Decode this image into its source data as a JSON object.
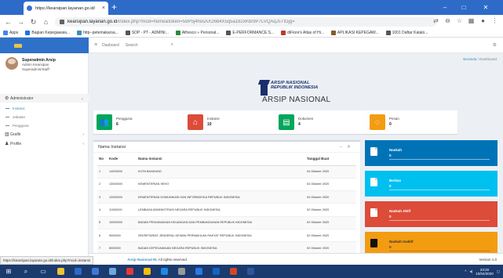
{
  "browser": {
    "tab_title": "https://kearsipan.layanan.go.id/",
    "url_domain": "kearsipan.layanan.go.id",
    "url_path": "/index.php?mod=home&token=59P5j4hosAX26b4X5q5a182xKbr9P7LVQAqJsTfDjg=",
    "bookmarks": [
      {
        "label": "Apps",
        "color": "#4285f4"
      },
      {
        "label": "Bagian Kepegawaia...",
        "color": "#1a73e8"
      },
      {
        "label": "http--petemakarsa...",
        "color": "#3c8dbc"
      },
      {
        "label": "SOP - PT - ADMINI...",
        "color": "#555555"
      },
      {
        "label": "Alfresco » Personal...",
        "color": "#2c8b3c"
      },
      {
        "label": "E-PERFORMANCE S...",
        "color": "#555555"
      },
      {
        "label": "diFiore's Atlas of Hi...",
        "color": "#c0392b"
      },
      {
        "label": "APLIKASI KEPEGAW...",
        "color": "#8a5a2b"
      },
      {
        "label": "1001 Daftar Katalo...",
        "color": "#555555"
      }
    ],
    "status_url": "https://kearsipan.layanan.go.id/index.php?mod=instansi"
  },
  "sidebar": {
    "brand": "Arsip",
    "user_name": "Superadmin Arsip",
    "user_role1": "Admin Kearsipan",
    "user_role2": "Superadmin/Staff",
    "admin_label": "Administrator",
    "sub_items": [
      "Instansi",
      "Jabatan",
      "Pengguna"
    ],
    "grafik_label": "Grafik",
    "profile_label": "Profile"
  },
  "topnav": {
    "link": "Dasboard",
    "search": "Search"
  },
  "breadcrumb": {
    "home": "Beranda",
    "current": "Dashboard"
  },
  "logo": {
    "line1": "ARSIP NASIONAL",
    "line2": "REPUBLIK INDONESIA",
    "title": "ARSIP NASIONAL"
  },
  "infoboxes": [
    {
      "label": "Pengguna",
      "value": "6",
      "color": "#00a65a",
      "icon": "users-icon"
    },
    {
      "label": "Instansi",
      "value": "10",
      "color": "#dd4b39",
      "icon": "home-icon"
    },
    {
      "label": "Dokumen",
      "value": "4",
      "color": "#00a65a",
      "icon": "document-icon"
    },
    {
      "label": "Pesan",
      "value": "0",
      "color": "#f39c12",
      "icon": "chat-icon"
    }
  ],
  "table": {
    "title": "Nama Instansi",
    "headers": [
      "No",
      "Kode",
      "Nama Instansi",
      "Tanggal Buat"
    ],
    "rows": [
      [
        "1",
        "14000000",
        "KOTA BANDUNG",
        "04 Oktober 2020"
      ],
      [
        "2",
        "13000000",
        "KEMENTERIAN SEHO",
        "04 Oktober 2020"
      ],
      [
        "3",
        "12000000",
        "KEMENTERIAN KOMUNIKASI DAN INFORMATIKA REPUBLIK INDONESIA",
        "04 Oktober 2020"
      ],
      [
        "4",
        "11000000",
        "LEMBAGA ADMINISTRASI NEGARA REPUBLIK INDONESIA",
        "02 Oktober 2020"
      ],
      [
        "5",
        "10000000",
        "BADAN PENGAWASAN KEUANGAN DAN PEMBANGUNAN REPUBLIK INDONESIA",
        "02 Oktober 2020"
      ],
      [
        "6",
        "9000000",
        "SEKRETARIAT JENDERAL DEWAN PERWAKILAN RAKYAT REPUBLIK INDONESIA",
        "02 Oktober 2020"
      ],
      [
        "7",
        "8000000",
        "BADAN KEPEGAWAIAN NEGARA REPUBLIK INDONESIA",
        "02 Oktober 2020"
      ]
    ]
  },
  "stat_boxes": [
    {
      "title": "Naskah",
      "value": "0",
      "color": "#0073b7"
    },
    {
      "title": "Berkas",
      "value": "0",
      "color": "#00c0ef"
    },
    {
      "title": "Naskah Aktif",
      "value": "0",
      "color": "#dd4b39"
    },
    {
      "title": "Naskah Inaktif",
      "value": "0",
      "color": "#f39c12"
    }
  ],
  "footer": {
    "copyright_suffix": "Arsip Nasional RI.",
    "rights": "All rights reserved.",
    "version": "Version 1.0"
  },
  "taskbar": {
    "time": "23:20",
    "date": "10/04/2020",
    "apps": [
      {
        "name": "file-explorer-icon",
        "color": "#f1c232"
      },
      {
        "name": "mail-icon",
        "color": "#2a6ac7"
      },
      {
        "name": "store-icon",
        "color": "#3c78d8"
      },
      {
        "name": "photos-icon",
        "color": "#6fa8dc"
      },
      {
        "name": "opera-icon",
        "color": "#e53935"
      },
      {
        "name": "chrome-icon",
        "color": "#fbbc05"
      },
      {
        "name": "edge-icon",
        "color": "#1e88e5"
      },
      {
        "name": "settings-icon",
        "color": "#999999"
      },
      {
        "name": "app-icon",
        "color": "#2b78e4"
      },
      {
        "name": "outlook-icon",
        "color": "#1565c0"
      },
      {
        "name": "powerpoint-icon",
        "color": "#d24726"
      },
      {
        "name": "word-icon",
        "color": "#2b579a"
      }
    ]
  }
}
